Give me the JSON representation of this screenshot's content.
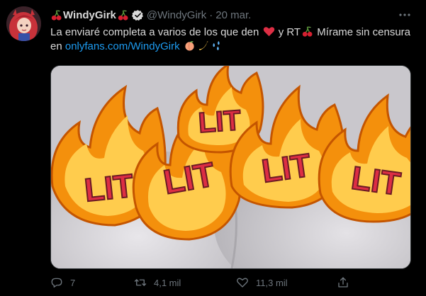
{
  "tweet": {
    "display_name": "WindyGirk",
    "handle": "@WindyGirk",
    "separator": "·",
    "date": "20 mar.",
    "text": {
      "line1_a": "La enviaré completa a varios de los que den",
      "line1_b": "y RT",
      "line1_c": "Mírame sin censura",
      "line2_a": "en",
      "link": "onlyfans.com/WindyGirk"
    },
    "media": {
      "sticker_labels": [
        "LIT",
        "LIT",
        "LIT",
        "LIT",
        "LIT"
      ]
    },
    "actions": {
      "replies": "7",
      "retweets": "4,1 mil",
      "likes": "11,3 mil"
    }
  },
  "colors": {
    "background": "#000000",
    "text": "#d9d9d9",
    "muted": "#6e767d",
    "link": "#1d9bf0",
    "verified": "#d9d9d9"
  },
  "icons": {
    "name_prefix": "cherry-icon",
    "name_suffix": "cherry-icon",
    "verified": "verified-badge-icon",
    "more": "more-icon",
    "reply": "reply-icon",
    "retweet": "retweet-icon",
    "like": "heart-icon",
    "share": "share-icon"
  }
}
